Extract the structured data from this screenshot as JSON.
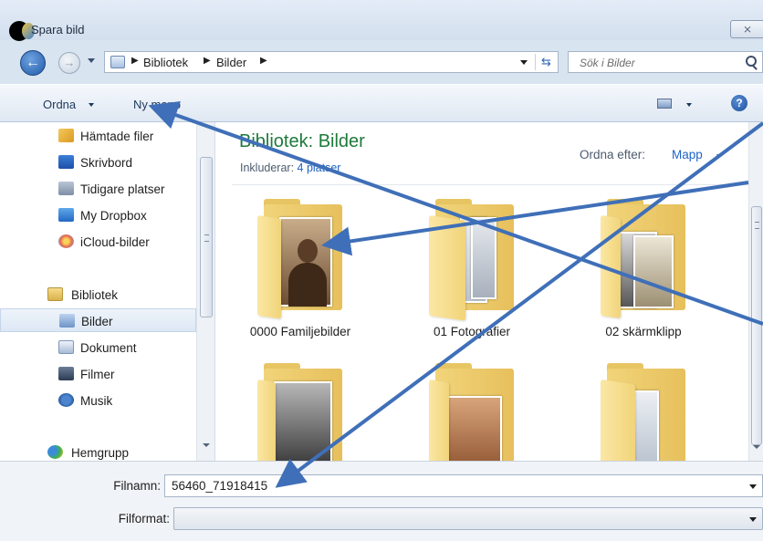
{
  "window": {
    "title": "Spara bild",
    "close_label": "⨯"
  },
  "address_bar": {
    "crumbs": [
      "Bibliotek",
      "Bilder"
    ],
    "separator": "▶",
    "search_placeholder": "Sök i Bilder"
  },
  "toolbar": {
    "organize_label": "Ordna",
    "new_folder_label": "Ny mapp",
    "help_label": "?"
  },
  "nav": {
    "items": [
      {
        "label": "Hämtade filer",
        "icon": "downloads-icon"
      },
      {
        "label": "Skrivbord",
        "icon": "desktop-icon"
      },
      {
        "label": "Tidigare platser",
        "icon": "recent-places-icon"
      },
      {
        "label": "My Dropbox",
        "icon": "dropbox-icon"
      },
      {
        "label": "iCloud-bilder",
        "icon": "icloud-photos-icon"
      },
      {
        "label": "Bibliotek",
        "icon": "library-icon"
      },
      {
        "label": "Bilder",
        "icon": "pictures-icon",
        "selected": true
      },
      {
        "label": "Dokument",
        "icon": "documents-icon"
      },
      {
        "label": "Filmer",
        "icon": "videos-icon"
      },
      {
        "label": "Musik",
        "icon": "music-icon"
      },
      {
        "label": "Hemgrupp",
        "icon": "homegroup-icon"
      }
    ]
  },
  "content": {
    "library_title": "Bibliotek: Bilder",
    "includes_prefix": "Inkluderar: ",
    "includes_link": "4 platser",
    "arrange_label": "Ordna efter:",
    "arrange_value": "Mapp",
    "folders": [
      {
        "label": "0000 Familjebilder"
      },
      {
        "label": "01 Fotografier"
      },
      {
        "label": "02 skärmklipp"
      },
      {
        "label": ""
      },
      {
        "label": ""
      },
      {
        "label": ""
      }
    ]
  },
  "form": {
    "filename_label": "Filnamn:",
    "filename_value": "56460_71918415",
    "fileformat_label": "Filformat:",
    "fileformat_value": ""
  },
  "colors": {
    "library_title": "#1e7a3a",
    "link": "#1f64c4",
    "annotation_arrow": "#3f6fb8"
  }
}
